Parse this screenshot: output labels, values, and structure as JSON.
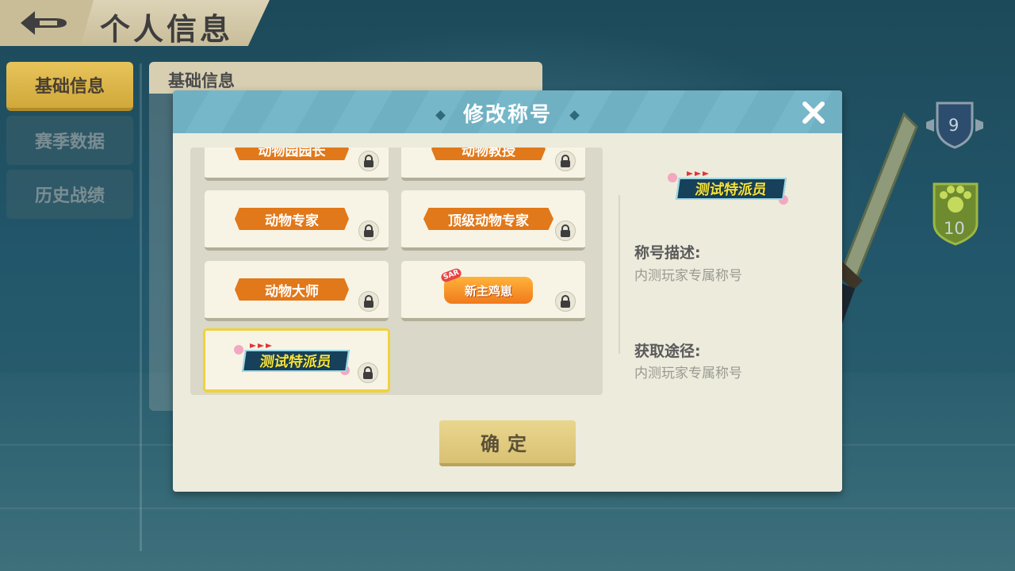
{
  "header": {
    "title": "个人信息"
  },
  "nav": {
    "items": [
      {
        "label": "基础信息",
        "active": true
      },
      {
        "label": "赛季数据",
        "active": false
      },
      {
        "label": "历史战绩",
        "active": false
      }
    ]
  },
  "background_panel": {
    "title": "基础信息"
  },
  "side_badges": {
    "shield_level": "9",
    "paw_level": "10"
  },
  "modal": {
    "title": "修改称号",
    "titles": [
      {
        "label": "动物园园长",
        "locked": true
      },
      {
        "label": "动物教授",
        "locked": true
      },
      {
        "label": "动物专家",
        "locked": true
      },
      {
        "label": "顶级动物专家",
        "locked": true
      },
      {
        "label": "动物大师",
        "locked": true
      },
      {
        "label": "新主鸡崽",
        "badge_tag": "SAR",
        "locked": true
      },
      {
        "label": "测试特派员",
        "locked": true,
        "selected": true
      }
    ],
    "preview": {
      "label": "测试特派员"
    },
    "description_label": "称号描述:",
    "description_value": "内测玩家专属称号",
    "source_label": "获取途径:",
    "source_value": "内测玩家专属称号",
    "confirm_label": "确定"
  },
  "colors": {
    "ribbon": "#e1781a",
    "selected_border": "#f0d23b",
    "header_bar": "#6fb0c2",
    "nav_active": "#d9b244"
  }
}
